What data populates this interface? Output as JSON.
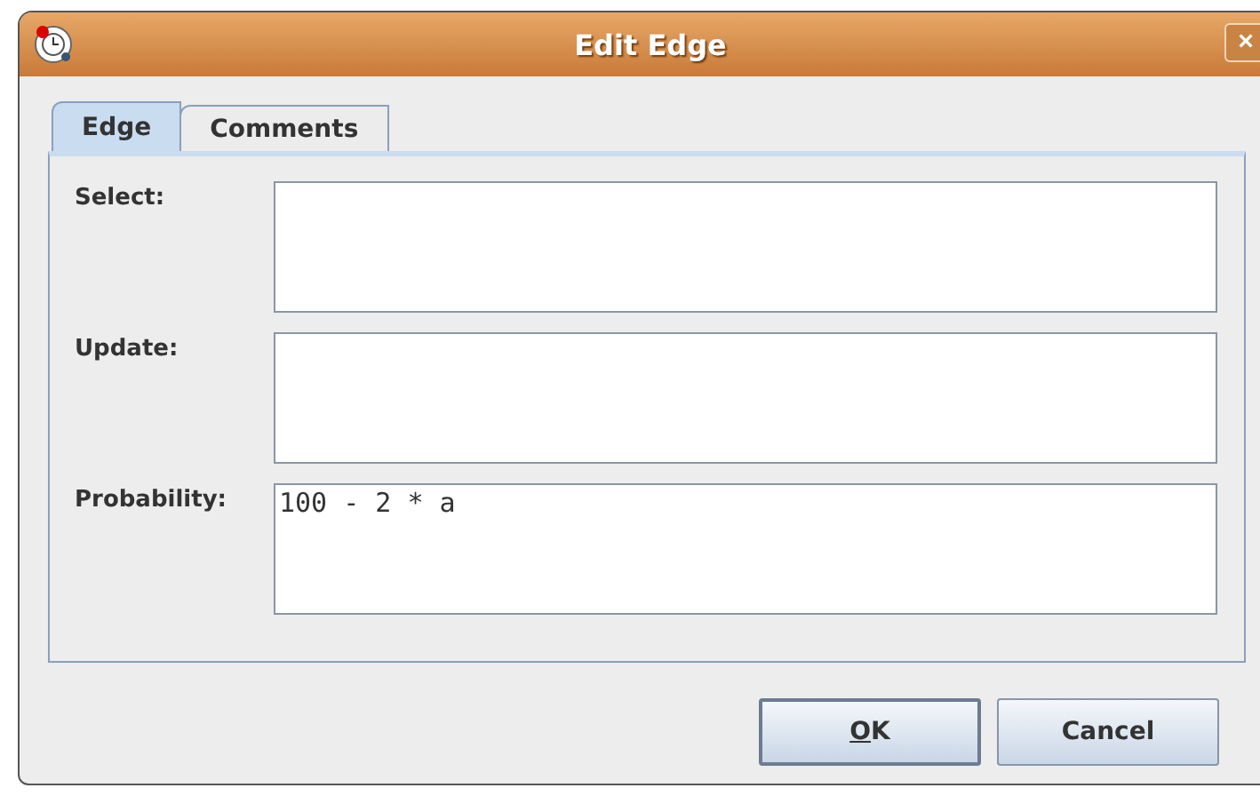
{
  "window": {
    "title": "Edit Edge",
    "close": "×"
  },
  "tabs": [
    {
      "label": "Edge",
      "selected": true
    },
    {
      "label": "Comments",
      "selected": false
    }
  ],
  "fields": [
    {
      "label": "Select:"
    },
    {
      "label": "Update:"
    },
    {
      "label": "Probability:",
      "value": "100 - 2 * a"
    }
  ],
  "buttons": [
    {
      "mnemonic": "O",
      "label_rest": "K",
      "default": true
    },
    {
      "label_rest": "Cancel",
      "default": false
    }
  ]
}
